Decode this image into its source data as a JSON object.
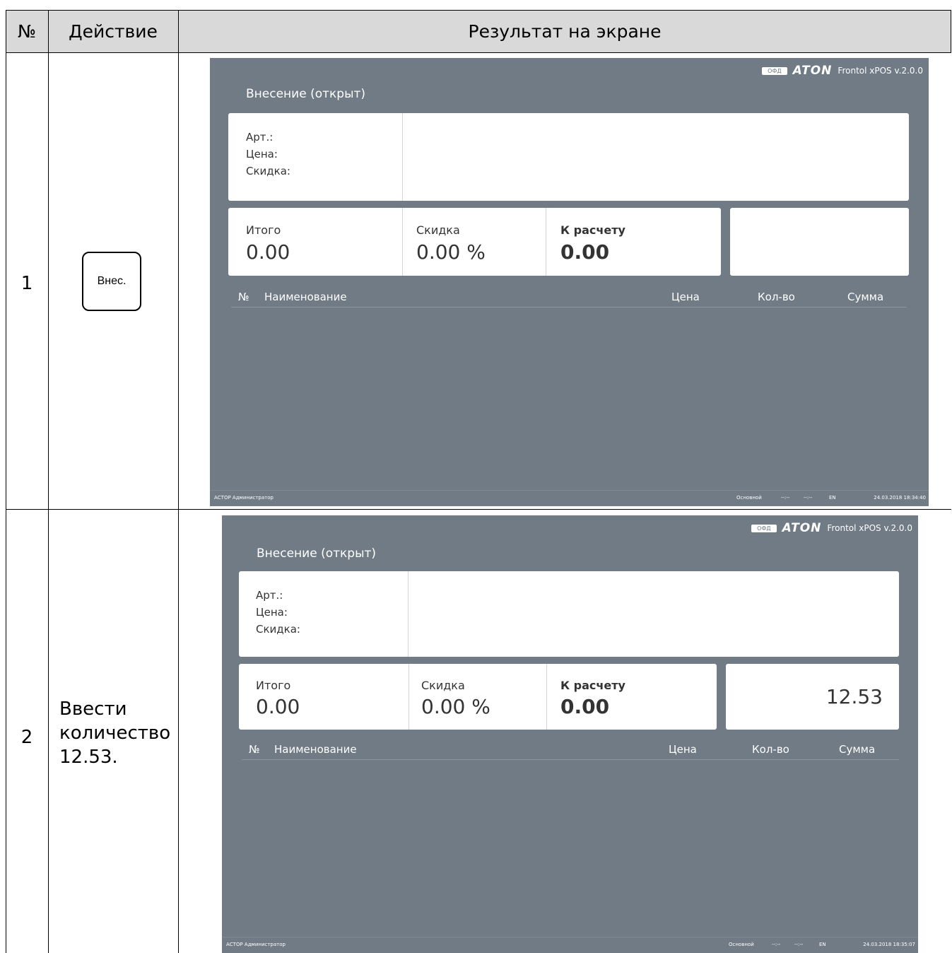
{
  "table": {
    "headers": {
      "number": "№",
      "action": "Действие",
      "result": "Результат на экране"
    },
    "rows": [
      {
        "number": "1",
        "action_key": "Внес."
      },
      {
        "number": "2",
        "action_lines": [
          "Ввести",
          "количество",
          "12.53."
        ]
      }
    ]
  },
  "screens": [
    {
      "brand": {
        "ofd": "ОФД",
        "logo": "ATON",
        "version": "Frontol xPOS v.2.0.0"
      },
      "title": "Внесение (открыт)",
      "item_labels": [
        "Арт.:",
        "Цена:",
        "Скидка:"
      ],
      "totals": {
        "total_label": "Итого",
        "total_value": "0.00",
        "discount_label": "Скидка",
        "discount_value": "0.00 %",
        "payable_label": "К расчету",
        "payable_value": "0.00"
      },
      "quantity": "",
      "columns": [
        "№",
        "Наименование",
        "Цена",
        "Кол-во",
        "Сумма"
      ],
      "status": {
        "user": "АСТОР Администратор",
        "mode": "Основной",
        "t1": "--:--",
        "t2": "--:--",
        "lang": "EN",
        "datetime": "24.03.2018 18:34:40"
      }
    },
    {
      "brand": {
        "ofd": "ОФД",
        "logo": "ATON",
        "version": "Frontol xPOS v.2.0.0"
      },
      "title": "Внесение (открыт)",
      "item_labels": [
        "Арт.:",
        "Цена:",
        "Скидка:"
      ],
      "totals": {
        "total_label": "Итого",
        "total_value": "0.00",
        "discount_label": "Скидка",
        "discount_value": "0.00 %",
        "payable_label": "К расчету",
        "payable_value": "0.00"
      },
      "quantity": "12.53",
      "columns": [
        "№",
        "Наименование",
        "Цена",
        "Кол-во",
        "Сумма"
      ],
      "status": {
        "user": "АСТОР Администратор",
        "mode": "Основной",
        "t1": "--:--",
        "t2": "--:--",
        "lang": "EN",
        "datetime": "24.03.2018 18:35:07"
      }
    }
  ]
}
